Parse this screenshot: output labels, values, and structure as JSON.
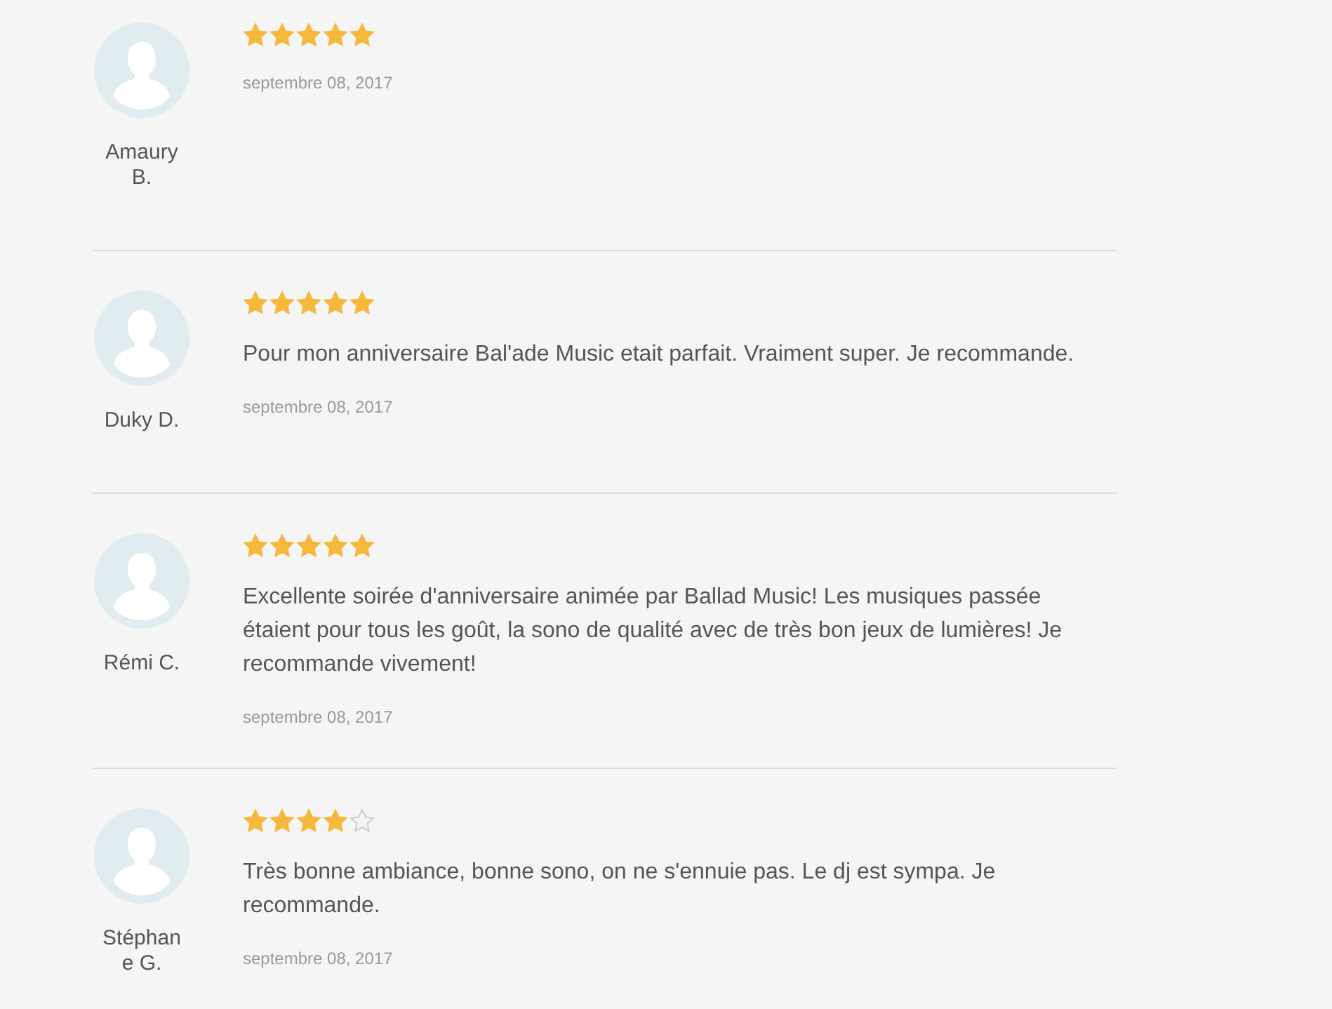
{
  "reviews": [
    {
      "name": "Amaury B.",
      "stars": 5,
      "date": "septembre 08, 2017"
    },
    {
      "name": "Duky D.",
      "stars": 5,
      "text": "Pour mon anniversaire Bal'ade Music etait parfait. Vraiment super. Je recommande.",
      "date": "septembre 08, 2017"
    },
    {
      "name": "Rémi C.",
      "stars": 5,
      "text": "Excellente soirée d'anniversaire animée par Ballad Music! Les musiques passée étaient pour tous les goût, la sono de qualité avec de très bon jeux de lumières! Je recommande vivement!",
      "date": "septembre 08, 2017"
    },
    {
      "name": "Stéphane G.",
      "stars": 4,
      "text": "Très bonne ambiance, bonne sono, on ne s'ennuie pas. Le dj est sympa. Je recommande.",
      "date": "septembre 08, 2017"
    }
  ]
}
